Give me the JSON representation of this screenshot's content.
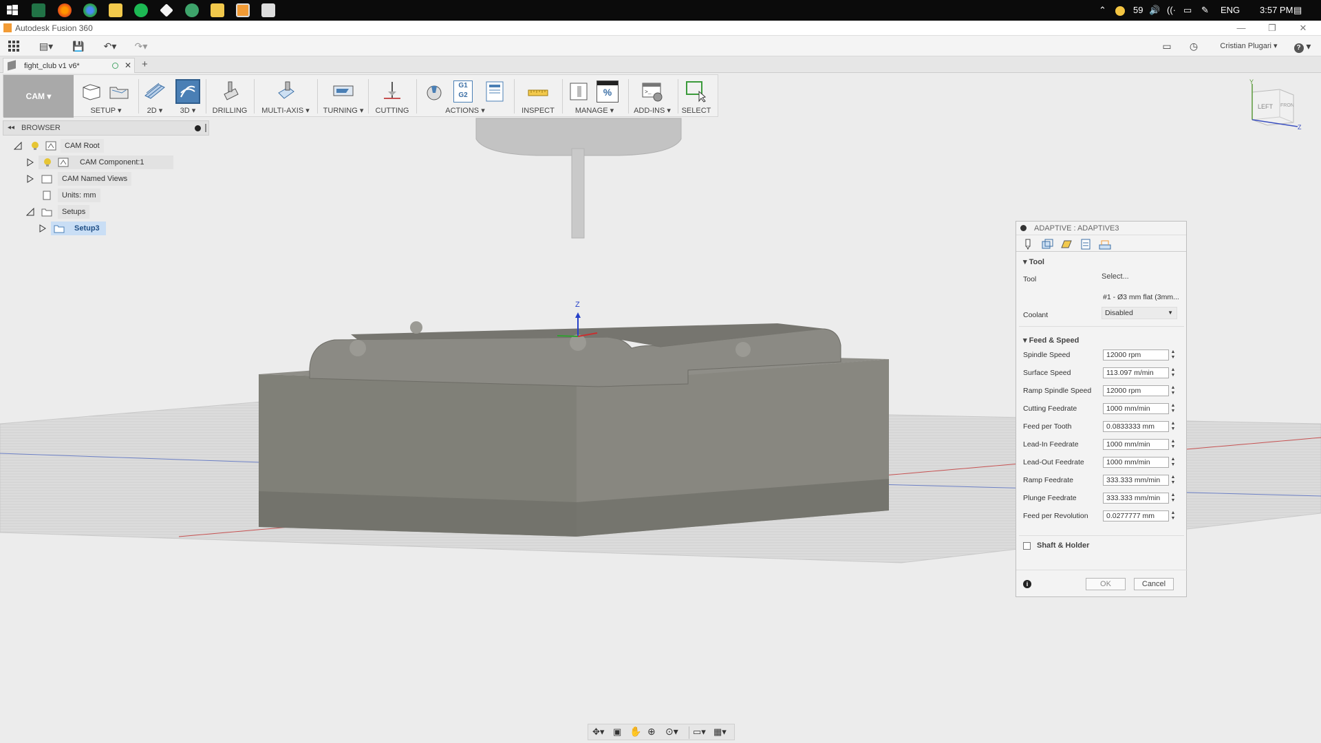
{
  "taskbar": {
    "battery_percent": "59",
    "language": "ENG",
    "clock": "3:57 PM"
  },
  "window": {
    "title": "Autodesk Fusion 360",
    "user": "Cristian Plugari",
    "help": "?"
  },
  "document": {
    "tab_label": "fight_club v1 v6*"
  },
  "ribbon": {
    "workspace": "CAM",
    "groups": [
      "SETUP",
      "2D",
      "3D",
      "DRILLING",
      "MULTI-AXIS",
      "TURNING",
      "CUTTING",
      "ACTIONS",
      "INSPECT",
      "MANAGE",
      "ADD-INS",
      "SELECT"
    ],
    "actions_g1": "G1",
    "actions_g2": "G2",
    "manage_percent": "%"
  },
  "browser": {
    "title": "BROWSER",
    "nodes": {
      "root": "CAM Root",
      "component": "CAM Component:1",
      "named_views": "CAM Named Views",
      "units": "Units: mm",
      "setups": "Setups",
      "setup3": "Setup3"
    }
  },
  "viewcube": {
    "left": "LEFT",
    "front": "FRONT",
    "axis_y": "Y",
    "axis_z": "Z"
  },
  "origin": {
    "axis_z": "Z"
  },
  "panel": {
    "title": "ADAPTIVE : ADAPTIVE3",
    "tool_section": "Tool",
    "tool_label": "Tool",
    "tool_select": "Select...",
    "tool_name": "#1 - Ø3 mm flat (3mm...",
    "coolant_label": "Coolant",
    "coolant_value": "Disabled",
    "feed_section": "Feed & Speed",
    "fields": [
      {
        "label": "Spindle Speed",
        "value": "12000 rpm"
      },
      {
        "label": "Surface Speed",
        "value": "113.097 m/min"
      },
      {
        "label": "Ramp Spindle Speed",
        "value": "12000 rpm"
      },
      {
        "label": "Cutting Feedrate",
        "value": "1000 mm/min"
      },
      {
        "label": "Feed per Tooth",
        "value": "0.0833333 mm"
      },
      {
        "label": "Lead-In Feedrate",
        "value": "1000 mm/min"
      },
      {
        "label": "Lead-Out Feedrate",
        "value": "1000 mm/min"
      },
      {
        "label": "Ramp Feedrate",
        "value": "333.333 mm/min"
      },
      {
        "label": "Plunge Feedrate",
        "value": "333.333 mm/min"
      },
      {
        "label": "Feed per Revolution",
        "value": "0.0277777 mm"
      }
    ],
    "shaft_section": "Shaft & Holder",
    "ok": "OK",
    "cancel": "Cancel"
  },
  "colors": {
    "ribbon_active": "#4a7fb5",
    "selection": "#c9def5",
    "stock": "#7b7a74",
    "bulb": "#e6c534"
  }
}
